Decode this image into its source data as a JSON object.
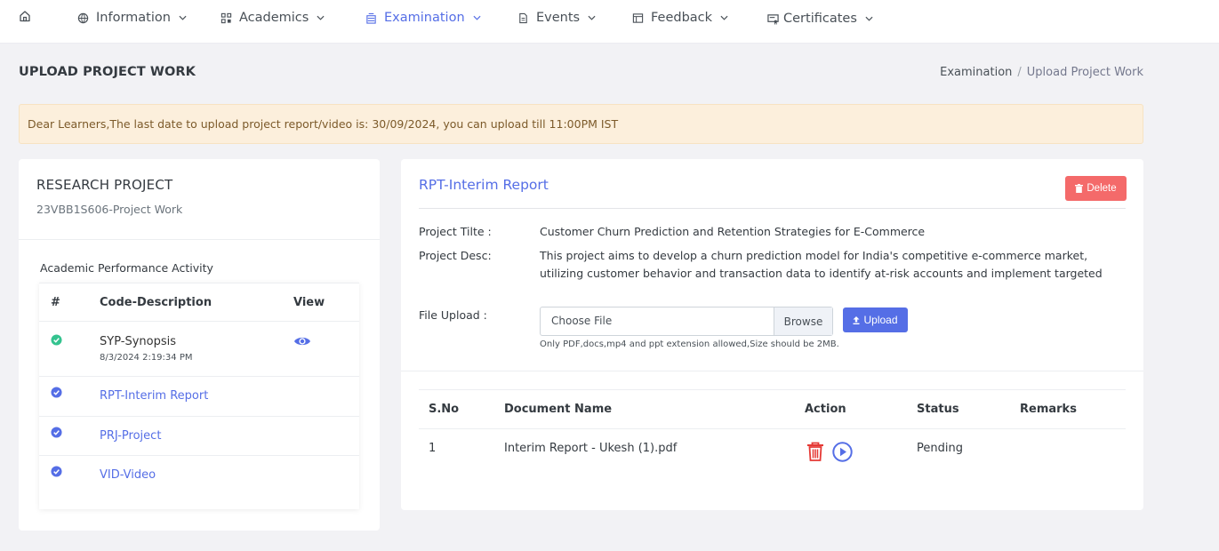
{
  "nav": {
    "items": [
      {
        "label": "Information",
        "icon": "globe-icon"
      },
      {
        "label": "Academics",
        "icon": "grid-icon"
      },
      {
        "label": "Examination",
        "icon": "exam-icon",
        "active": true
      },
      {
        "label": "Events",
        "icon": "file-icon"
      },
      {
        "label": "Feedback",
        "icon": "window-icon"
      },
      {
        "label": "Certificates",
        "icon": "certificate-icon"
      }
    ],
    "accent": "#556ee6"
  },
  "page": {
    "title": "UPLOAD PROJECT WORK",
    "breadcrumb": {
      "parent": "Examination",
      "separator": "/",
      "current": "Upload Project Work"
    }
  },
  "alert": {
    "text": "Dear Learners,The last date to upload project report/video is: 30/09/2024, you can upload till 11:00PM IST"
  },
  "left": {
    "title": "RESEARCH PROJECT",
    "subtitle": "23VBB1S606-Project Work",
    "section_title": "Academic Performance Activity",
    "columns": [
      "#",
      "Code-Description",
      "View"
    ],
    "rows": [
      {
        "code": "SYP-Synopsis",
        "date": "8/3/2024 2:19:34 PM",
        "status_color": "#34c38f",
        "linked": false,
        "has_view": true
      },
      {
        "code": "RPT-Interim Report",
        "date": "",
        "status_color": "#556ee6",
        "linked": true,
        "has_view": false
      },
      {
        "code": "PRJ-Project",
        "date": "",
        "status_color": "#556ee6",
        "linked": true,
        "has_view": false
      },
      {
        "code": "VID-Video",
        "date": "",
        "status_color": "#556ee6",
        "linked": true,
        "has_view": false
      }
    ]
  },
  "right": {
    "title": "RPT-Interim Report",
    "delete_label": "Delete",
    "project_title_label": "Project Tilte :",
    "project_title": "Customer Churn Prediction and Retention Strategies for E-Commerce",
    "project_desc_label": "Project Desc:",
    "project_desc": "This project aims to develop a churn prediction model for India's competitive e-commerce market, utilizing customer behavior and transaction data to identify at-risk accounts and implement targeted",
    "file_upload_label": "File Upload :",
    "file_placeholder": "Choose File",
    "browse_label": "Browse",
    "upload_label": "Upload",
    "hint": "Only PDF,docs,mp4 and ppt extension allowed,Size should be 2MB.",
    "table": {
      "columns": [
        "S.No",
        "Document Name",
        "Action",
        "Status",
        "Remarks"
      ],
      "rows": [
        {
          "sno": "1",
          "name": "Interim Report - Ukesh (1).pdf",
          "status": "Pending",
          "remarks": ""
        }
      ]
    },
    "colors": {
      "delete": "#f46a6a",
      "trash": "#e53935",
      "play": "#556ee6"
    }
  }
}
